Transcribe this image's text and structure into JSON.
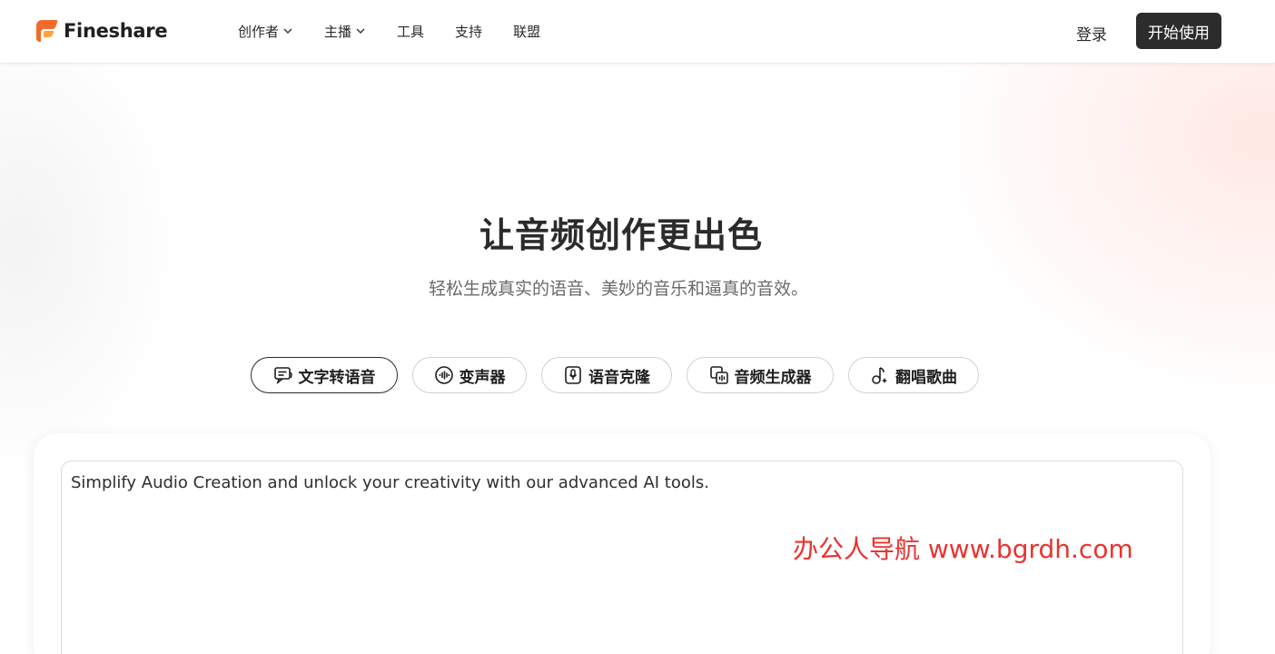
{
  "header": {
    "brand": "Fineshare",
    "nav": [
      {
        "label": "创作者",
        "has_dropdown": true
      },
      {
        "label": "主播",
        "has_dropdown": true
      },
      {
        "label": "工具",
        "has_dropdown": false
      },
      {
        "label": "支持",
        "has_dropdown": false
      },
      {
        "label": "联盟",
        "has_dropdown": false
      }
    ],
    "login_label": "登录",
    "start_label": "开始使用"
  },
  "hero": {
    "title": "让音频创作更出色",
    "subtitle": "轻松生成真实的语音、美妙的音乐和逼真的音效。"
  },
  "tabs": [
    {
      "label": "文字转语音",
      "icon": "text-to-speech-icon",
      "active": true
    },
    {
      "label": "变声器",
      "icon": "waveform-icon",
      "active": false
    },
    {
      "label": "语音克隆",
      "icon": "microphone-icon",
      "active": false
    },
    {
      "label": "音频生成器",
      "icon": "audio-generator-icon",
      "active": false
    },
    {
      "label": "翻唱歌曲",
      "icon": "music-note-icon",
      "active": false
    }
  ],
  "editor": {
    "value": "Simplify Audio Creation and unlock your creativity with our advanced AI tools."
  },
  "watermark": "办公人导航 www.bgrdh.com",
  "colors": {
    "brand_orange": "#f26b2a",
    "dark_button": "#2c2c2c",
    "watermark_red": "#e8342f"
  }
}
